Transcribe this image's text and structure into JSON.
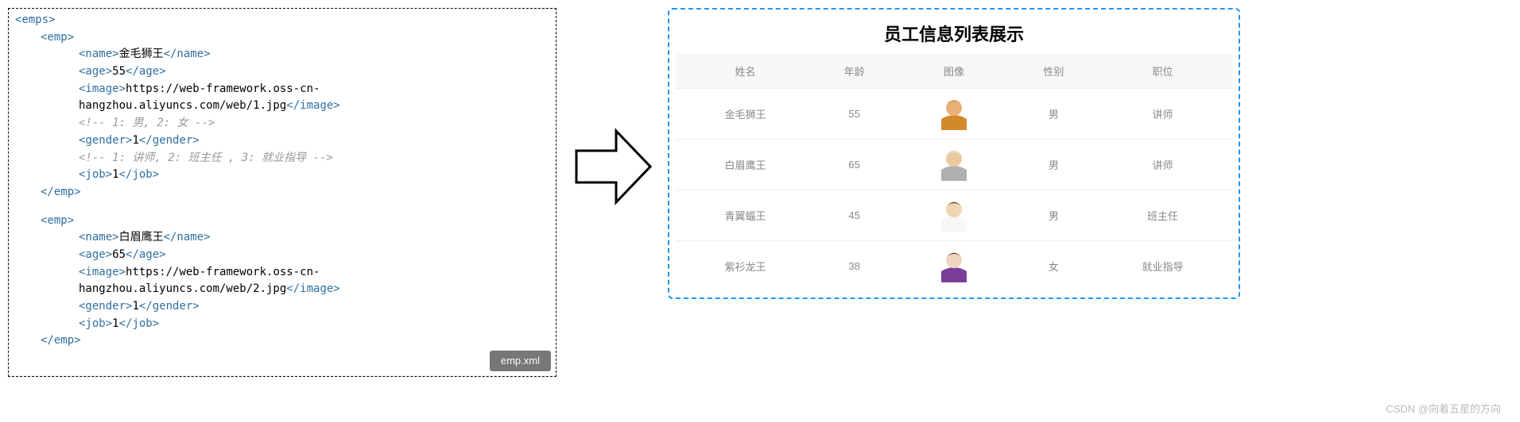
{
  "xml": {
    "filename": "emp.xml",
    "root_open": "<emps>",
    "emp_open": "<emp>",
    "emp_close": "</emp>",
    "tag_name_open": "<name>",
    "tag_name_close": "</name>",
    "tag_age_open": "<age>",
    "tag_age_close": "</age>",
    "tag_image_open": "<image>",
    "tag_image_close": "</image>",
    "tag_gender_open": "<gender>",
    "tag_gender_close": "</gender>",
    "tag_job_open": "<job>",
    "tag_job_close": "</job>",
    "comment_gender": "<!-- 1: 男, 2: 女 -->",
    "comment_job": "<!-- 1: 讲师, 2: 班主任 , 3: 就业指导 -->",
    "emp1": {
      "name": "金毛狮王",
      "age": "55",
      "image": "https://web-framework.oss-cn-hangzhou.aliyuncs.com/web/1.jpg",
      "gender": "1",
      "job": "1"
    },
    "emp2": {
      "name": "白眉鹰王",
      "age": "65",
      "image": "https://web-framework.oss-cn-hangzhou.aliyuncs.com/web/2.jpg",
      "gender": "1",
      "job": "1"
    }
  },
  "table": {
    "title": "员工信息列表展示",
    "headers": {
      "name": "姓名",
      "age": "年龄",
      "image": "图像",
      "gender": "性别",
      "job": "职位"
    },
    "rows": [
      {
        "name": "金毛狮王",
        "age": "55",
        "gender": "男",
        "job": "讲师",
        "avatar": {
          "skin": "#e9b07a",
          "garb": "#d08a2a",
          "hair": "#c89040"
        }
      },
      {
        "name": "白眉鹰王",
        "age": "65",
        "gender": "男",
        "job": "讲师",
        "avatar": {
          "skin": "#e9c9a0",
          "garb": "#b0b0b0",
          "hair": "#eeeeee"
        }
      },
      {
        "name": "青翼蝠王",
        "age": "45",
        "gender": "男",
        "job": "班主任",
        "avatar": {
          "skin": "#f0d6b0",
          "garb": "#f7f7f7",
          "hair": "#1a1a1a"
        }
      },
      {
        "name": "紫衫龙王",
        "age": "38",
        "gender": "女",
        "job": "就业指导",
        "avatar": {
          "skin": "#f0d6c0",
          "garb": "#7a3e9a",
          "hair": "#1a1a1a"
        }
      }
    ]
  },
  "watermark": "CSDN @向着五星的方向"
}
